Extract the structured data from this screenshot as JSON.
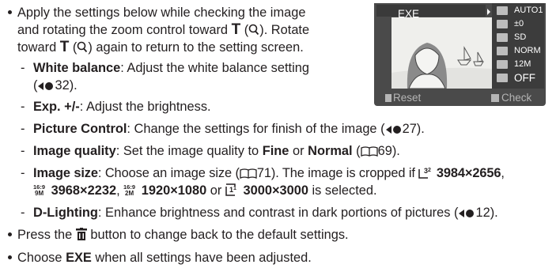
{
  "text": {
    "b1_l1": "Apply the settings below while checking the image",
    "b1_l2_pre": "and rotating the zoom control toward ",
    "tele": "T",
    "b1_l2_post": ". Rotate",
    "b1_l3_pre": "toward ",
    "b1_l3_post": " again to return to the setting screen.",
    "wb_term": "White balance",
    "wb_desc": ": Adjust the white balance setting",
    "wb_ref": "32).",
    "exp_term": "Exp. +/-",
    "exp_desc": ": Adjust the brightness.",
    "pc_term": "Picture Control",
    "pc_desc": ": Change the settings for finish of the image (",
    "pc_ref": "27).",
    "iq_term": "Image quality",
    "iq_desc": ": Set the image quality to ",
    "iq_fine": "Fine",
    "iq_or": " or ",
    "iq_normal": "Normal",
    "iq_ref": "69).",
    "is_term": "Image size",
    "is_desc": ": Choose an image size (",
    "is_ref": "71). The image is cropped if ",
    "size1": "3984×2656",
    "size2": "3968×2232",
    "size3": "1920×1080",
    "size4": "3000×3000",
    "is_end": " is selected.",
    "icon_32": "3\n2",
    "icon_169a": "16:9\n9M",
    "icon_169b": "16:9\n2M",
    "icon_11": "1\n1",
    "dl_term": "D-Lighting",
    "dl_desc": ": Enhance brightness and contrast in dark portions of pictures (",
    "dl_ref": "12).",
    "b2_pre": "Press the ",
    "b2_post": " button to change back to the default settings.",
    "b3_pre": "Choose ",
    "b3_exe": "EXE",
    "b3_post": " when all settings have been adjusted.",
    "comma": ", ",
    "or": " or "
  },
  "camera_screen": {
    "exe_label": "EXE",
    "settings": [
      {
        "icon": "wb-icon",
        "value": "AUTO1"
      },
      {
        "icon": "exposure-icon",
        "value": "±0"
      },
      {
        "icon": "picture-control-icon",
        "value": "SD"
      },
      {
        "icon": "image-quality-icon",
        "value": "NORM"
      },
      {
        "icon": "image-size-icon",
        "value": "12M"
      },
      {
        "icon": "d-lighting-icon",
        "value": "OFF"
      }
    ],
    "reset_label": "Reset",
    "check_label": "Check"
  },
  "colors": {
    "text": "#231f20",
    "screen_bg": "#4a4a4a"
  }
}
